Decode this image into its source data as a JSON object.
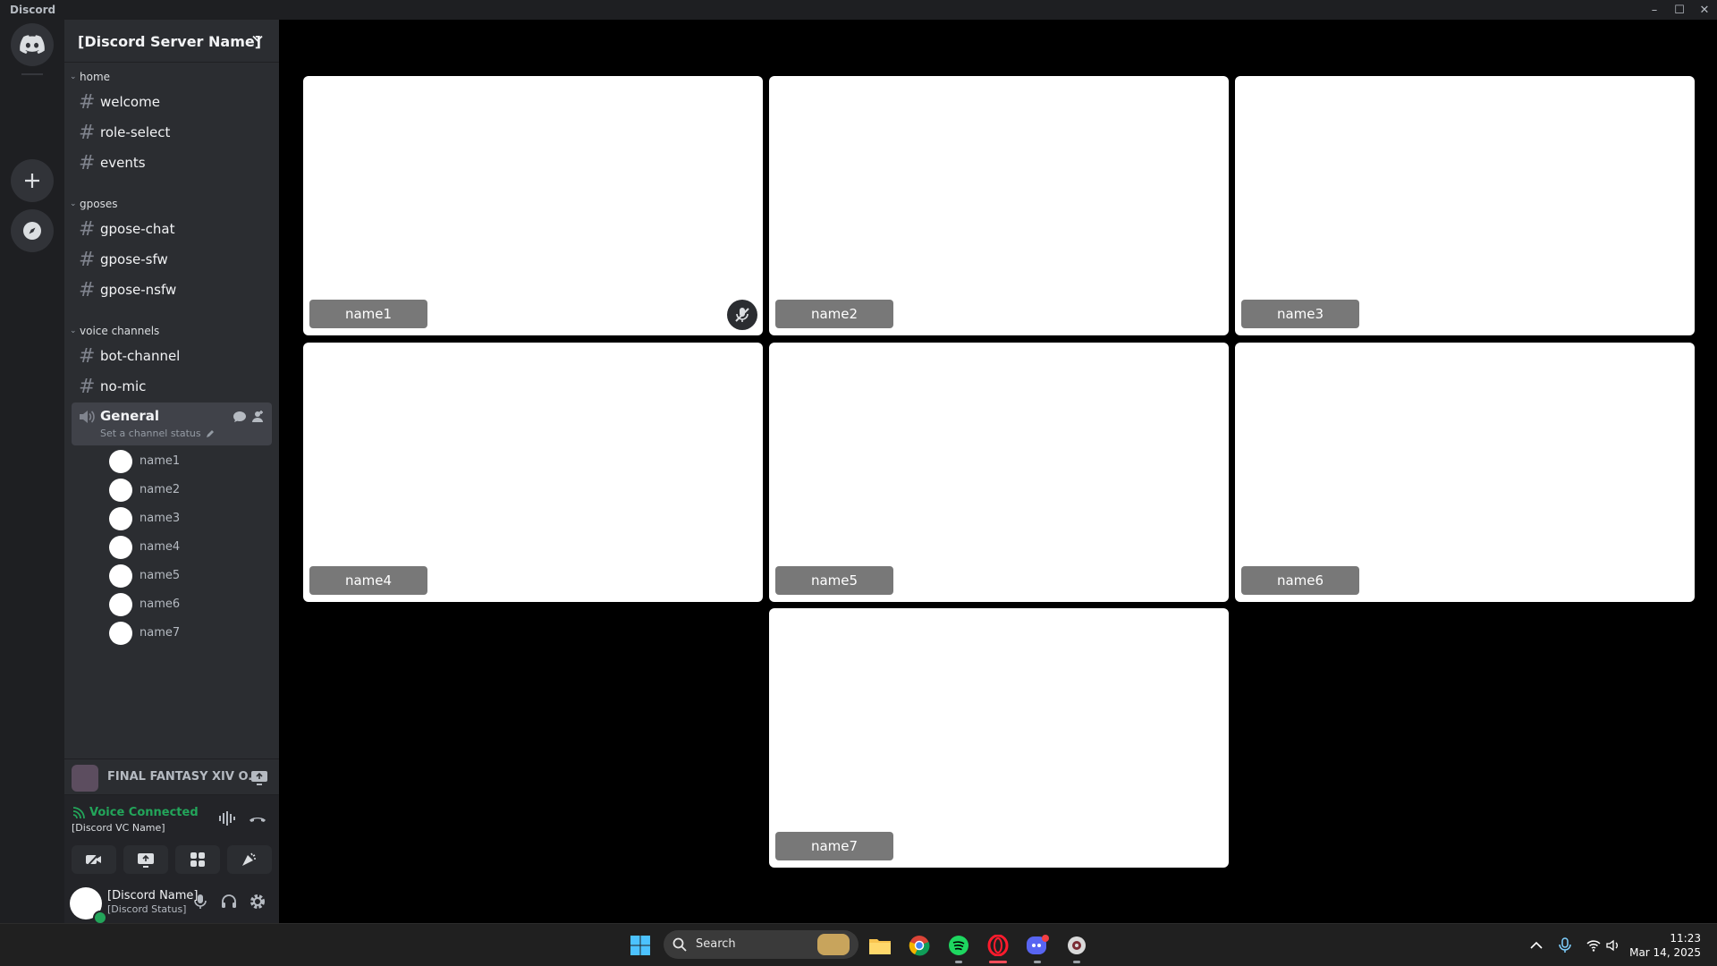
{
  "window": {
    "title": "Discord",
    "controls": [
      "minimize",
      "maximize",
      "close"
    ]
  },
  "rail": {
    "items": [
      "discord-home-icon",
      "add-server-icon",
      "explore-icon"
    ]
  },
  "server": {
    "name": "[Discord Server Name]"
  },
  "categories": [
    {
      "label": "home",
      "channels": [
        "welcome",
        "role-select",
        "events"
      ]
    },
    {
      "label": "gposes",
      "channels": [
        "gpose-chat",
        "gpose-sfw",
        "gpose-nsfw"
      ]
    },
    {
      "label": "voice channels",
      "channels": [
        "bot-channel",
        "no-mic"
      ]
    }
  ],
  "voice_channel": {
    "name": "General",
    "status": "Set a channel status",
    "members": [
      "name1",
      "name2",
      "name3",
      "name4",
      "name5",
      "name6",
      "name7"
    ]
  },
  "activity": {
    "game": "FINAL FANTASY XIV O..."
  },
  "voice_panel": {
    "status": "Voice Connected",
    "channel": "[Discord VC Name]"
  },
  "user": {
    "name": "[Discord Name]",
    "status": "[Discord Status]",
    "presence_color": "#23a55a"
  },
  "tiles": [
    {
      "name": "name1",
      "muted": true
    },
    {
      "name": "name2",
      "muted": false
    },
    {
      "name": "name3",
      "muted": false
    },
    {
      "name": "name4",
      "muted": false
    },
    {
      "name": "name5",
      "muted": false
    },
    {
      "name": "name6",
      "muted": false
    },
    {
      "name": "name7",
      "muted": false
    }
  ],
  "taskbar": {
    "search_label": "Search",
    "time": "11:23",
    "date": "Mar 14, 2025"
  },
  "colors": {
    "accent": "#5865f2",
    "voice_green": "#23a55a",
    "sidebar": "#2b2d31",
    "rail": "#1e1f22"
  }
}
